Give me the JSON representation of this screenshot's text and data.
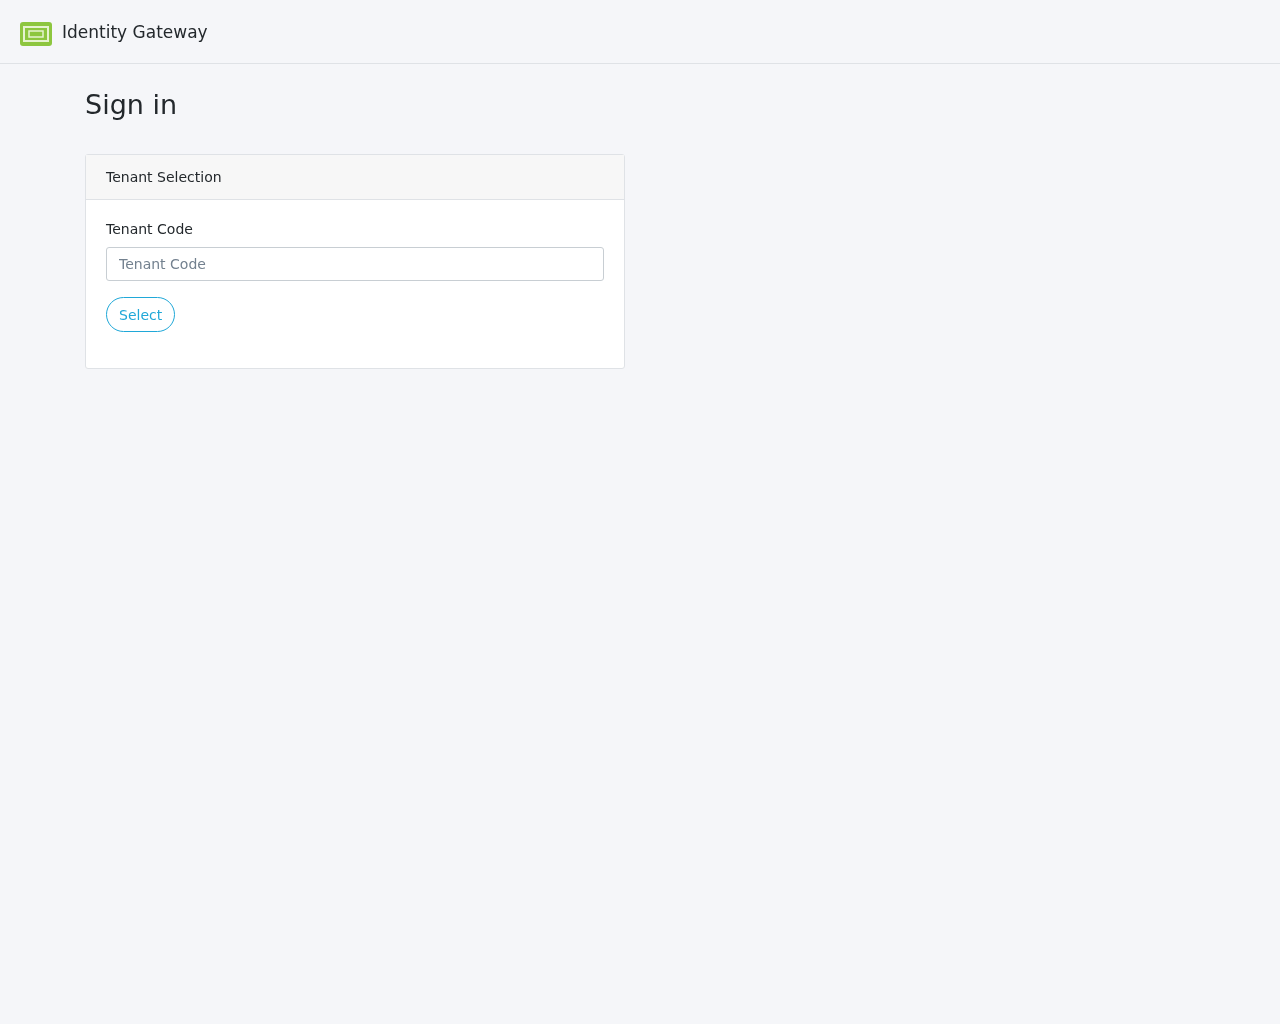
{
  "header": {
    "title": "Identity Gateway"
  },
  "page_title": "Sign in",
  "card": {
    "title": "Tenant Selection",
    "field": {
      "label": "Tenant Code",
      "placeholder": "Tenant Code"
    },
    "button": "Select"
  }
}
